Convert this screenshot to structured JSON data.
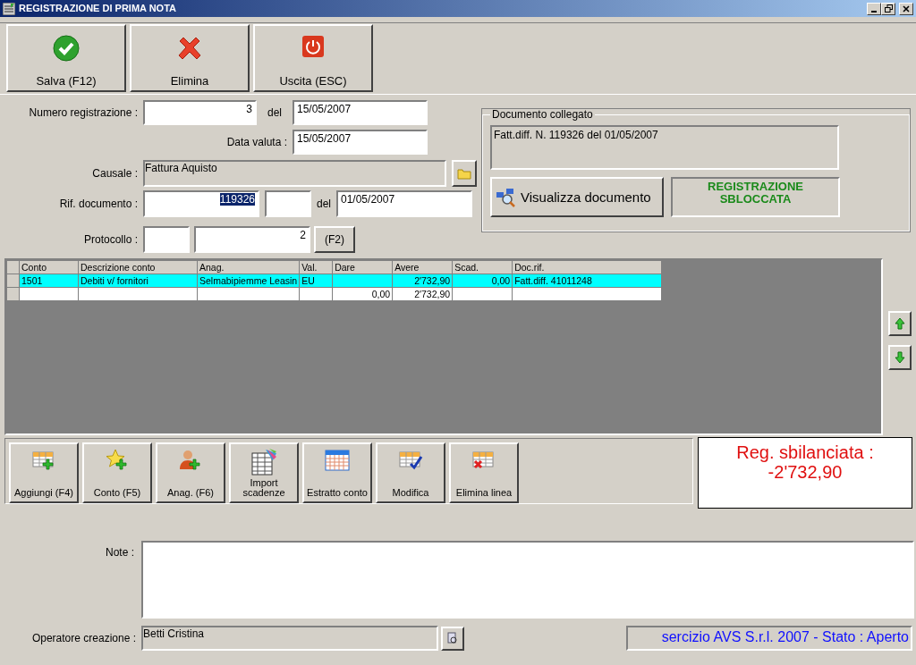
{
  "window": {
    "title": "REGISTRAZIONE DI PRIMA NOTA"
  },
  "toolbar": [
    {
      "label": "Salva (F12)",
      "kind": "save"
    },
    {
      "label": "Elimina",
      "kind": "delete"
    },
    {
      "label": "Uscita (ESC)",
      "kind": "exit"
    }
  ],
  "form": {
    "numero_label": "Numero registrazione :",
    "numero": "3",
    "del_label": "del",
    "data": "15/05/2007",
    "valuta_label": "Data valuta :",
    "valuta": "15/05/2007",
    "causale_label": "Causale :",
    "causale": "Fattura Aquisto",
    "rif_label": "Rif. documento :",
    "rif_numero": "119326",
    "rif_numero_highlighted": true,
    "rif_del_label": "del",
    "rif_data": "01/05/2007",
    "protocollo_label": "Protocollo :",
    "protocollo": "2",
    "protocollo_button": "(F2)"
  },
  "documento_collegato": {
    "title": "Documento collegato",
    "text": "Fatt.diff. N. 119326 del 01/05/2007",
    "button": "Visualizza documento",
    "status": "REGISTRAZIONE\nSBLOCCATA"
  },
  "table": {
    "columns": [
      {
        "label": "Conto",
        "kind": "text"
      },
      {
        "label": "Descrizione conto",
        "kind": "text"
      },
      {
        "label": "Anag.",
        "kind": "text"
      },
      {
        "label": "Val.",
        "kind": "text"
      },
      {
        "label": "Dare",
        "kind": "number"
      },
      {
        "label": "Avere",
        "kind": "number"
      },
      {
        "label": "Scad.",
        "kind": "number"
      },
      {
        "label": "Doc.rif.",
        "kind": "text"
      }
    ],
    "rows": [
      {
        "selected": true,
        "cells": [
          "1501",
          "Debiti v/ fornitori",
          "Selmabipiemme Leasin",
          "EU",
          "",
          "2'732,90",
          "0,00",
          "Fatt.diff. 41011248"
        ]
      },
      {
        "selected": false,
        "cells": [
          "",
          "",
          "",
          "",
          "0,00",
          "2'732,90",
          "",
          ""
        ]
      }
    ]
  },
  "line_tools": [
    {
      "label": "Aggiungi (F4)",
      "kind": "add-row"
    },
    {
      "label": "Conto (F5)",
      "kind": "star-add"
    },
    {
      "label": "Anag. (F6)",
      "kind": "person-add"
    },
    {
      "label": "Import\nscadenze",
      "kind": "import"
    },
    {
      "label": "Estratto conto",
      "kind": "calendar"
    },
    {
      "label": "Modifica",
      "kind": "modify"
    },
    {
      "label": "Elimina linea",
      "kind": "delete-row"
    }
  ],
  "balance": {
    "label": "Reg. sbilanciata :",
    "value": "-2'732,90"
  },
  "note": {
    "label": "Note :"
  },
  "operatore": {
    "label": "Operatore creazione :",
    "value": "Betti Cristina"
  },
  "status_bar": "sercizio AVS S.r.l. 2007 - Stato : Aperto"
}
